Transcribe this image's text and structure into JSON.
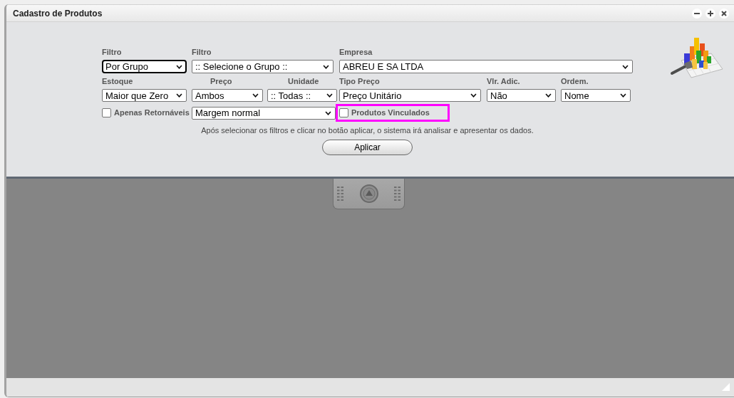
{
  "window": {
    "title": "Cadastro de Produtos"
  },
  "filters": [
    [
      {
        "kind": "select",
        "label": "Filtro",
        "value": "Por Grupo",
        "focused": true
      },
      {
        "kind": "select",
        "label": "Filtro",
        "value": ":: Selecione o Grupo ::",
        "focused": false
      },
      {
        "kind": "select",
        "label": "Empresa",
        "value": "ABREU E SA LTDA",
        "focused": false
      }
    ],
    [
      {
        "kind": "select",
        "label": "Estoque",
        "value": "Maior que Zero",
        "focused": false
      },
      {
        "kind": "select",
        "label": "Preço",
        "value": "Ambos",
        "focused": false
      },
      {
        "kind": "select",
        "label": "Unidade",
        "value": ":: Todas ::",
        "focused": false
      },
      {
        "kind": "select",
        "label": "Tipo Preço",
        "value": "Preço Unitário",
        "focused": false
      },
      {
        "kind": "select",
        "label": "Vlr. Adic.",
        "value": "Não",
        "focused": false
      },
      {
        "kind": "select",
        "label": "Ordem.",
        "value": "Nome",
        "focused": false
      }
    ],
    [
      {
        "kind": "checkbox",
        "label": "Apenas Retornáveis",
        "checked": false,
        "highlighted": false
      },
      {
        "kind": "select",
        "value": "Margem normal",
        "focused": false
      },
      {
        "kind": "checkbox",
        "label": "Produtos Vinculados",
        "checked": false,
        "highlighted": true
      }
    ]
  ],
  "hint": "Após selecionar os filtros e clicar no botão aplicar, o sistema irá analisar e apresentar os dados.",
  "apply_button": "Aplicar"
}
